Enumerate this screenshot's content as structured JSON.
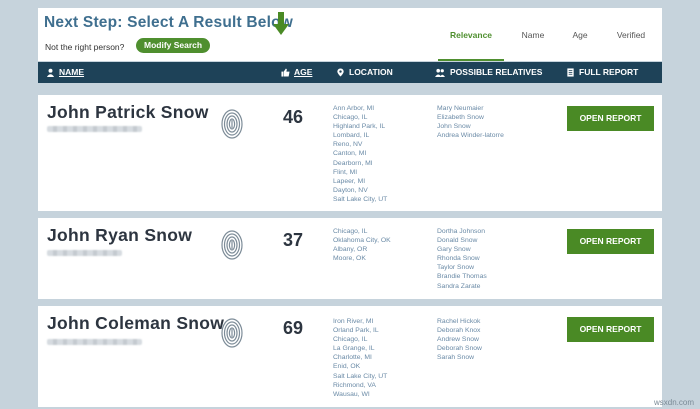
{
  "top": {
    "title": "Next Step: Select A Result Below",
    "not_right": "Not the right person?",
    "modify_button": "Modify Search",
    "sort_tabs": [
      {
        "label": "Relevance"
      },
      {
        "label": "Name"
      },
      {
        "label": "Age"
      },
      {
        "label": "Verified"
      }
    ],
    "active_tab": "Relevance"
  },
  "columns": {
    "name": "NAME",
    "age": "AGE",
    "location": "LOCATION",
    "relatives": "POSSIBLE RELATIVES",
    "report": "FULL REPORT"
  },
  "results": [
    {
      "name": "John Patrick Snow",
      "age": "46",
      "locations": [
        "Ann Arbor, MI",
        "Chicago, IL",
        "Highland Park, IL",
        "Lombard, IL",
        "Reno, NV",
        "Canton, MI",
        "Dearborn, MI",
        "Flint, MI",
        "Lapeer, MI",
        "Dayton, NV",
        "Salt Lake City, UT"
      ],
      "relatives": [
        "Mary Neumaier",
        "Elizabeth Snow",
        "John Snow",
        "Andrea Winder-latorre"
      ],
      "button": "OPEN REPORT"
    },
    {
      "name": "John Ryan Snow",
      "age": "37",
      "locations": [
        "Chicago, IL",
        "Oklahoma City, OK",
        "Albany, OR",
        "Moore, OK"
      ],
      "relatives": [
        "Dortha Johnson",
        "Donald Snow",
        "Gary Snow",
        "Rhonda Snow",
        "Taylor Snow",
        "Brandie Thomas",
        "Sandra Zarate"
      ],
      "button": "OPEN REPORT"
    },
    {
      "name": "John Coleman Snow",
      "age": "69",
      "locations": [
        "Iron River, MI",
        "Orland Park, IL",
        "Chicago, IL",
        "La Grange, IL",
        "Charlotte, MI",
        "Enid, OK",
        "Salt Lake City, UT",
        "Richmond, VA",
        "Wausau, WI"
      ],
      "relatives": [
        "Rachel Hickok",
        "Deborah Knox",
        "Andrew Snow",
        "Deborah Snow",
        "Sarah Snow"
      ],
      "button": "OPEN REPORT"
    }
  ],
  "watermark": "wsxdn.com",
  "colors": {
    "accent_green": "#4a8a25",
    "header_navy": "#1e4258",
    "title_blue": "#3f6f8f"
  },
  "icons": {
    "arrow": "down-arrow-icon",
    "fingerprint": "fingerprint-icon"
  }
}
